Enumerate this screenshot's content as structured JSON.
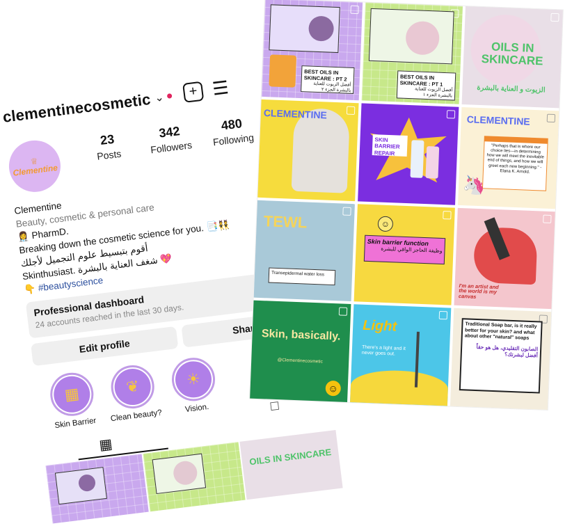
{
  "profile": {
    "username": "clementinecosmetic",
    "avatar_text": "Clementine",
    "stats": [
      {
        "value": "23",
        "label": "Posts"
      },
      {
        "value": "342",
        "label": "Followers"
      },
      {
        "value": "480",
        "label": "Following"
      }
    ],
    "bio": {
      "name": "Clementine",
      "category": "Beauty, cosmetic & personal care",
      "line1": "👩‍⚕️ PharmD.",
      "line2": "Breaking down the cosmetic science for you. 📑👯",
      "line3": "أقوم بتبسيط علوم التجميل لأجلك",
      "line4": "Skinthusiast. شغف العناية بالبشرة 💖",
      "hashtag": "👇 #beautyscience"
    },
    "dashboard": {
      "title": "Professional dashboard",
      "subtitle": "24 accounts reached in the last 30 days."
    },
    "buttons": {
      "edit": "Edit profile",
      "share": "Share pro"
    },
    "highlights": [
      {
        "label": "Skin Barrier",
        "icon": "brick-icon"
      },
      {
        "label": "Clean beauty?",
        "icon": "leaf-icon"
      },
      {
        "label": "Vision.",
        "icon": "bulb-icon"
      }
    ],
    "mini_captions": [
      "",
      "",
      "OILS IN SKINCARE"
    ]
  },
  "feed": {
    "tiles": [
      {
        "caption": "BEST OILS IN SKINCARE : PT 2",
        "sub": "أفضل الزيوت للعناية بالبشرة الجزء ٢",
        "bg": "#c9a8ee",
        "accent": "#ffffff"
      },
      {
        "caption": "BEST OILS IN SKINCARE : PT 1",
        "sub": "أفضل الزيوت للعناية بالبشرة الجزء ١",
        "bg": "#c7e88a",
        "accent": "#ffffff"
      },
      {
        "caption": "OILS IN SKINCARE",
        "sub": "الزيوت و العناية بالبشرة",
        "bg": "#e9dfe7",
        "accent": "#4fc36a"
      },
      {
        "caption": "CLEMENTINE",
        "sub": "",
        "bg": "#f6dc3d",
        "accent": "#5a6df0"
      },
      {
        "caption": "SKIN BARRIER REPAIR",
        "sub": "",
        "bg": "#7b2ee0",
        "accent": "#f7c13c"
      },
      {
        "caption": "CLEMENTINE",
        "sub": "\"Perhaps that is where our choice lies—in determining how we will meet the inevitable end of things, and how we will greet each new beginning.\" - Elana K. Arnold.",
        "bg": "#fbf1d6",
        "accent": "#ef8a2e"
      },
      {
        "caption": "TEWL",
        "sub": "Transepidermal water loss",
        "bg": "#a9c9d8",
        "accent": "#f5d45a"
      },
      {
        "caption": "Skin barrier function",
        "sub": "وظيفة الحاجز الواقي للبشرة",
        "bg": "#f7d940",
        "accent": "#e36acb"
      },
      {
        "caption": "I'm an artist and the world is my canvas",
        "sub": "",
        "bg": "#f4c6cd",
        "accent": "#c52a2a"
      },
      {
        "caption": "Skin, basically.",
        "sub": "@Clementinecosmetic",
        "bg": "#1f8e4d",
        "accent": "#f7e7a2"
      },
      {
        "caption": "Light",
        "sub": "There's a light and it never goes out.",
        "bg": "#4cc6e8",
        "accent": "#f5c20e"
      },
      {
        "caption": "Traditional Soap bar, is it really better for your skin? and what about other \"natural\" soaps",
        "sub": "الصابون التقليدي، هل هو حقاً أفضل لبشرتك؟",
        "bg": "#f4eddd",
        "accent": "#6b2fb8"
      }
    ]
  }
}
